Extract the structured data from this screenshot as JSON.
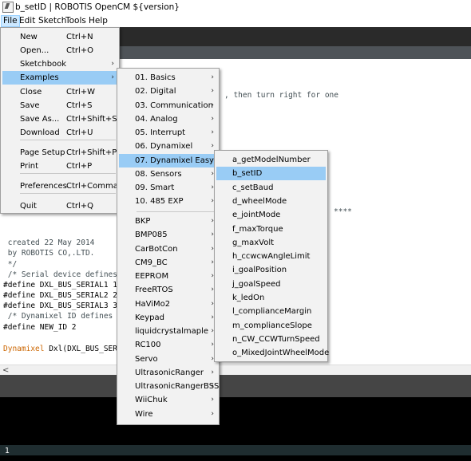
{
  "window": {
    "title": "b_setID | ROBOTIS OpenCM ${version}"
  },
  "menubar": {
    "items": [
      "File",
      "Edit",
      "Sketch",
      "Tools",
      "Help"
    ]
  },
  "editor": {
    "visible_fragment_1": ", then turn right for one",
    "visible_fragment_2": "****",
    "lines": [
      " created 22 May 2014",
      " by ROBOTIS CO,.LTD.",
      " */",
      " /* Serial device defines",
      "#define DXL_BUS_SERIAL1 1",
      "#define DXL_BUS_SERIAL2 2",
      "#define DXL_BUS_SERIAL3 3",
      " /* Dynamixel ID defines *",
      "#define NEW_ID 2"
    ],
    "last_line_keyword": "Dynamixel",
    "last_line_rest": " Dxl(DXL_BUS_SERI"
  },
  "footer": {
    "line_number": "1"
  },
  "file_menu": [
    {
      "label": "New",
      "shortcut": "Ctrl+N"
    },
    {
      "label": "Open...",
      "shortcut": "Ctrl+O"
    },
    {
      "label": "Sketchbook",
      "shortcut": "",
      "submenu": true
    },
    {
      "label": "Examples",
      "shortcut": "",
      "submenu": true,
      "highlighted": true
    },
    {
      "label": "Close",
      "shortcut": "Ctrl+W"
    },
    {
      "label": "Save",
      "shortcut": "Ctrl+S"
    },
    {
      "label": "Save As...",
      "shortcut": "Ctrl+Shift+S"
    },
    {
      "label": "Download",
      "shortcut": "Ctrl+U"
    },
    {
      "label": "Page Setup",
      "shortcut": "Ctrl+Shift+P"
    },
    {
      "label": "Print",
      "shortcut": "Ctrl+P"
    },
    {
      "label": "Preferences",
      "shortcut": "Ctrl+Comma"
    },
    {
      "label": "Quit",
      "shortcut": "Ctrl+Q"
    }
  ],
  "examples_menu": [
    "01. Basics",
    "02. Digital",
    "03. Communication",
    "04. Analog",
    "05. Interrupt",
    "06. Dynamixel",
    "07. Dynamixel Easy",
    "08. Sensors",
    "09. Smart",
    "10. 485 EXP",
    "BKP",
    "BMP085",
    "CarBotCon",
    "CM9_BC",
    "EEPROM",
    "FreeRTOS",
    "HaViMo2",
    "Keypad",
    "liquidcrystalmaple",
    "RC100",
    "Servo",
    "UltrasonicRanger",
    "UltrasonicRangerBSS",
    "WiiChuk",
    "Wire"
  ],
  "examples_submenu_flags": [
    true,
    true,
    true,
    true,
    true,
    true,
    true,
    true,
    true,
    true,
    true,
    true,
    true,
    true,
    true,
    true,
    true,
    true,
    true,
    true,
    true,
    true,
    true,
    true,
    true
  ],
  "examples_highlighted": "07. Dynamixel Easy",
  "dynamixel_easy_menu": [
    "a_getModelNumber",
    "b_setID",
    "c_setBaud",
    "d_wheelMode",
    "e_jointMode",
    "f_maxTorque",
    "g_maxVolt",
    "h_ccwcwAngleLimit",
    "i_goalPosition",
    "j_goalSpeed",
    "k_ledOn",
    "l_complianceMargin",
    "m_complianceSlope",
    "n_CW_CCWTurnSpeed",
    "o_MixedJointWheelMode"
  ],
  "dynamixel_easy_highlighted": "b_setID",
  "icons": {
    "app": "robotis-app-icon",
    "submenu": "chevron-right-icon",
    "scroll_left": "scroll-left-arrow-icon"
  },
  "colors": {
    "highlight": "#99ccf5",
    "menu_bg": "#f2f2f2",
    "keyword": "#cc6600"
  }
}
